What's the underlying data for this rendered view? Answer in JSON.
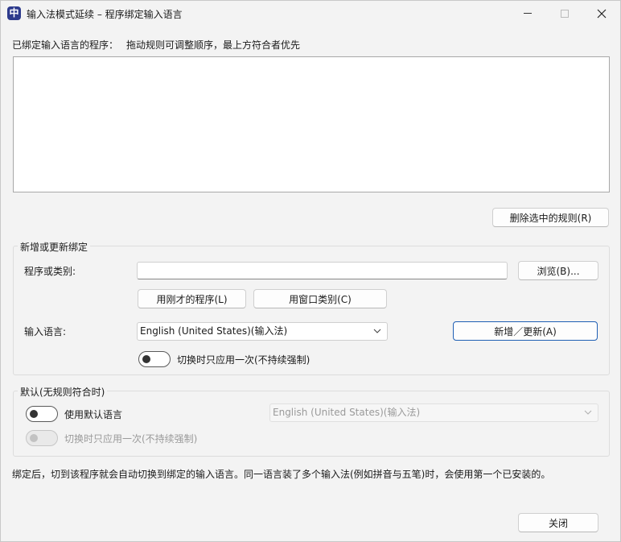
{
  "window": {
    "app_icon_glyph": "中",
    "title": "输入法模式延续 – 程序绑定输入语言"
  },
  "rules": {
    "header_label": "已绑定输入语言的程序：",
    "header_hint": "拖动规则可调整顺序，最上方符合者优先",
    "items": [],
    "delete_button": "删除选中的规则(R)"
  },
  "edit_group": {
    "legend": "新增或更新绑定",
    "program_label": "程序或类别:",
    "program_value": "",
    "browse_button": "浏览(B)...",
    "use_last_program_button": "用刚才的程序(L)",
    "use_window_class_button": "用窗口类别(C)",
    "input_language_label": "输入语言:",
    "input_language_value": "English (United States)(输入法)",
    "add_update_button": "新增／更新(A)",
    "apply_once_toggle_label": "切换时只应用一次(不持续强制)",
    "apply_once_on": false
  },
  "default_group": {
    "legend": "默认(无规则符合时)",
    "use_default_toggle_label": "使用默认语言",
    "use_default_on": false,
    "default_language_value": "English (United States)(输入法)",
    "apply_once_toggle_label": "切换时只应用一次(不持续强制)",
    "apply_once_on": false
  },
  "footer": {
    "note": "绑定后，切到该程序就会自动切换到绑定的输入语言。同一语言装了多个输入法(例如拼音与五笔)时，会使用第一个已安装的。",
    "close_button": "关闭"
  }
}
